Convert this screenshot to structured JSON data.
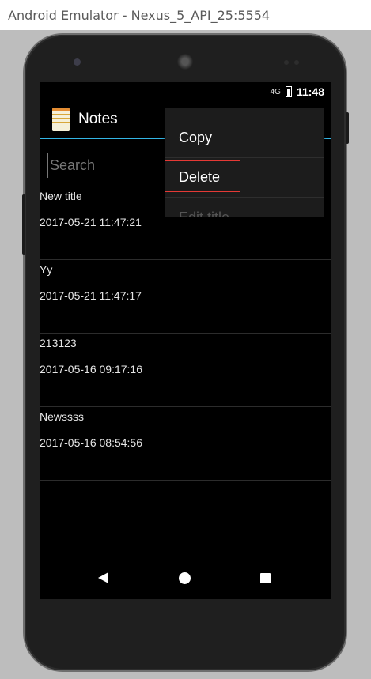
{
  "window": {
    "title": "Android Emulator - Nexus_5_API_25:5554"
  },
  "status_bar": {
    "signal": "4G",
    "time": "11:48"
  },
  "action_bar": {
    "title": "Notes"
  },
  "search": {
    "placeholder": "Search",
    "value": ""
  },
  "notes": [
    {
      "title": "New title",
      "date": "2017-05-21 11:47:21"
    },
    {
      "title": "Yy",
      "date": "2017-05-21 11:47:17"
    },
    {
      "title": "213123",
      "date": "2017-05-16 09:17:16"
    },
    {
      "title": "Newssss",
      "date": "2017-05-16 08:54:56"
    }
  ],
  "context_menu": {
    "items": [
      {
        "label": "Copy"
      },
      {
        "label": "Delete"
      },
      {
        "label": "Edit title"
      }
    ]
  },
  "colors": {
    "accent": "#33b5e5",
    "highlight": "#e53935"
  }
}
